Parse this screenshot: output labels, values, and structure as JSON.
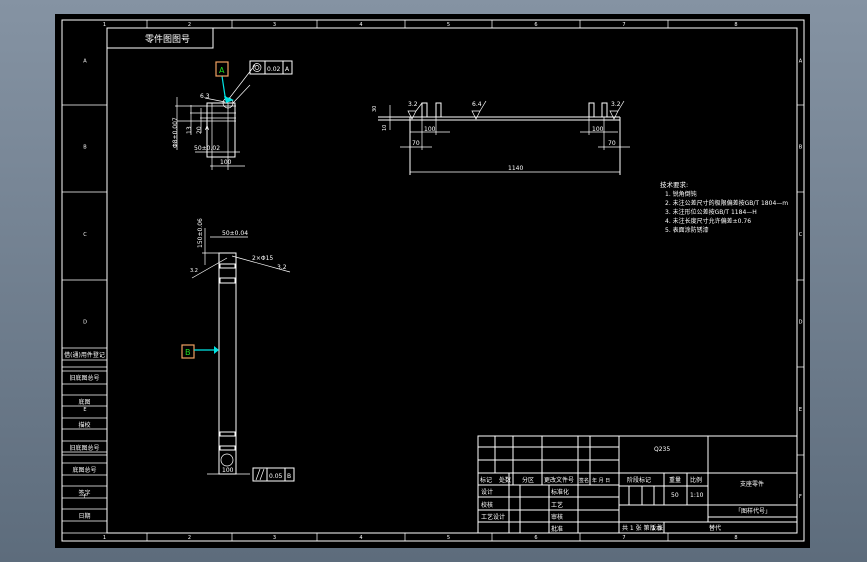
{
  "colors": {
    "canvas": "#000000",
    "lines": "#ffffff",
    "leader": "#00e5e5",
    "marker_border": "#f0a060",
    "marker_text": "#22dd22"
  },
  "frame": {
    "top_zones": [
      "1",
      "2",
      "3",
      "4",
      "5",
      "6",
      "7",
      "8"
    ],
    "side_zones": [
      "A",
      "B",
      "C",
      "D",
      "E",
      "F"
    ]
  },
  "stamp_box": {
    "label": "零件图图号"
  },
  "left_column": [
    "借(通)用件登记",
    "旧底图总号",
    "底图",
    "描校",
    "旧底图总号",
    "底图总号",
    "签字",
    "日期"
  ],
  "views": {
    "top_left": {
      "datum_marker": "A",
      "tolerance_value": "0.02",
      "tolerance_datum": "A",
      "roughness": "6.3",
      "dim_phi": "Φ8±0.007",
      "dim_small": "13",
      "dim_mid": "20",
      "dim_tol": "50±0.02",
      "dim_width": "100",
      "label_a": "A"
    },
    "right": {
      "roughness_left": "3.2",
      "roughness_mid": "6.4",
      "roughness_right": "3.2",
      "dim_left_inner": "100",
      "dim_right_inner": "100",
      "dim_left_outer": "70",
      "dim_right_outer": "70",
      "dim_total": "1140",
      "dim_h1": "30",
      "dim_h2": "10"
    },
    "bottom_left": {
      "datum_marker": "B",
      "dim_top": "50±0.04",
      "dim_side": "150±0.06",
      "note": "2×Φ15",
      "roughness": "3.2",
      "roughness_b": "3.2",
      "dim_width": "100",
      "parallel_value": "0.05",
      "parallel_datum": "B"
    }
  },
  "tech_requirements": {
    "title": "技术要求:",
    "items": [
      "1. 锐角倒钝",
      "2. 未注公差尺寸的极限偏差按GB/T 1804—m",
      "3. 未注形位公差按GB/T 1184—H",
      "4. 未注长度尺寸允许偏差±0.76",
      "5. 表面涂防锈漆"
    ]
  },
  "title_block": {
    "material": "Q235",
    "change_headers": [
      "标记",
      "处数",
      "分区",
      "更改文件号",
      "签名",
      "年 月 日"
    ],
    "left_rows": [
      "设计",
      "校核",
      "工艺设计",
      ""
    ],
    "mid_rows": [
      "标准化",
      "工艺",
      "审核",
      "批准"
    ],
    "stage_headers": [
      "阶段标记",
      "重量",
      "比例"
    ],
    "scale": "1:10",
    "weight": "50",
    "name": "支座零件",
    "drawing_no": "「图样代号」",
    "sheet": "共 1 张 第 1 张",
    "version": "版本",
    "replace": "替代"
  }
}
